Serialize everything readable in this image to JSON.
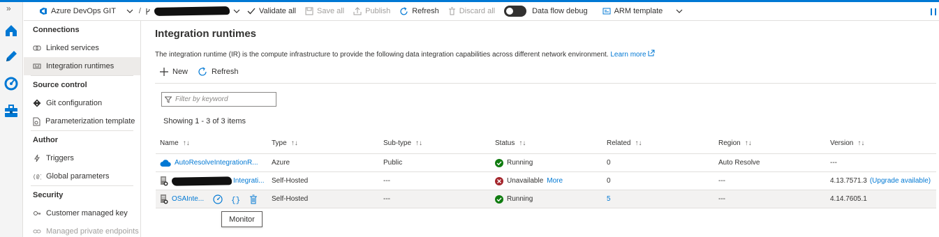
{
  "toolbar": {
    "repo_label": "Azure DevOps GIT",
    "validate_all": "Validate all",
    "save_all": "Save all",
    "publish": "Publish",
    "refresh": "Refresh",
    "discard_all": "Discard all",
    "data_flow_debug": "Data flow debug",
    "arm_template": "ARM template"
  },
  "sidebar": {
    "sections": [
      {
        "title": "Connections",
        "items": [
          {
            "label": "Linked services",
            "icon": "linked-services-icon"
          },
          {
            "label": "Integration runtimes",
            "icon": "integration-runtimes-icon",
            "selected": true
          }
        ]
      },
      {
        "title": "Source control",
        "items": [
          {
            "label": "Git configuration",
            "icon": "git-icon"
          },
          {
            "label": "Parameterization template",
            "icon": "template-icon"
          }
        ]
      },
      {
        "title": "Author",
        "items": [
          {
            "label": "Triggers",
            "icon": "trigger-icon"
          },
          {
            "label": "Global parameters",
            "icon": "parameters-icon"
          }
        ]
      },
      {
        "title": "Security",
        "items": [
          {
            "label": "Customer managed key",
            "icon": "key-icon"
          },
          {
            "label": "Managed private endpoints",
            "icon": "endpoint-icon",
            "disabled": true
          }
        ]
      }
    ]
  },
  "main": {
    "title": "Integration runtimes",
    "description": "The integration runtime (IR) is the compute infrastructure to provide the following data integration capabilities across different network environment.",
    "learn_more": "Learn more",
    "new_label": "New",
    "refresh_label": "Refresh",
    "filter_placeholder": "Filter by keyword",
    "showing": "Showing 1 - 3 of 3 items",
    "columns": [
      "Name",
      "Type",
      "Sub-type",
      "Status",
      "Related",
      "Region",
      "Version"
    ],
    "rows": [
      {
        "name": "AutoResolveIntegrationR...",
        "type": "Azure",
        "subtype": "Public",
        "status": "Running",
        "status_kind": "ok",
        "related": "0",
        "region": "Auto Resolve",
        "version": "---",
        "version_link": ""
      },
      {
        "name": "Integrati...",
        "type": "Self-Hosted",
        "subtype": "---",
        "status": "Unavailable",
        "status_kind": "error",
        "status_more": "More",
        "related": "0",
        "region": "---",
        "version": "4.13.7571.3",
        "version_link": "(Upgrade available)"
      },
      {
        "name": "OSAInte...",
        "type": "Self-Hosted",
        "subtype": "---",
        "status": "Running",
        "status_kind": "ok",
        "related": "5",
        "region": "---",
        "version": "4.14.7605.1",
        "version_link": ""
      }
    ],
    "tooltip": "Monitor"
  },
  "colors": {
    "accent": "#0078d4",
    "ok": "#107c10",
    "error": "#a4262c"
  }
}
